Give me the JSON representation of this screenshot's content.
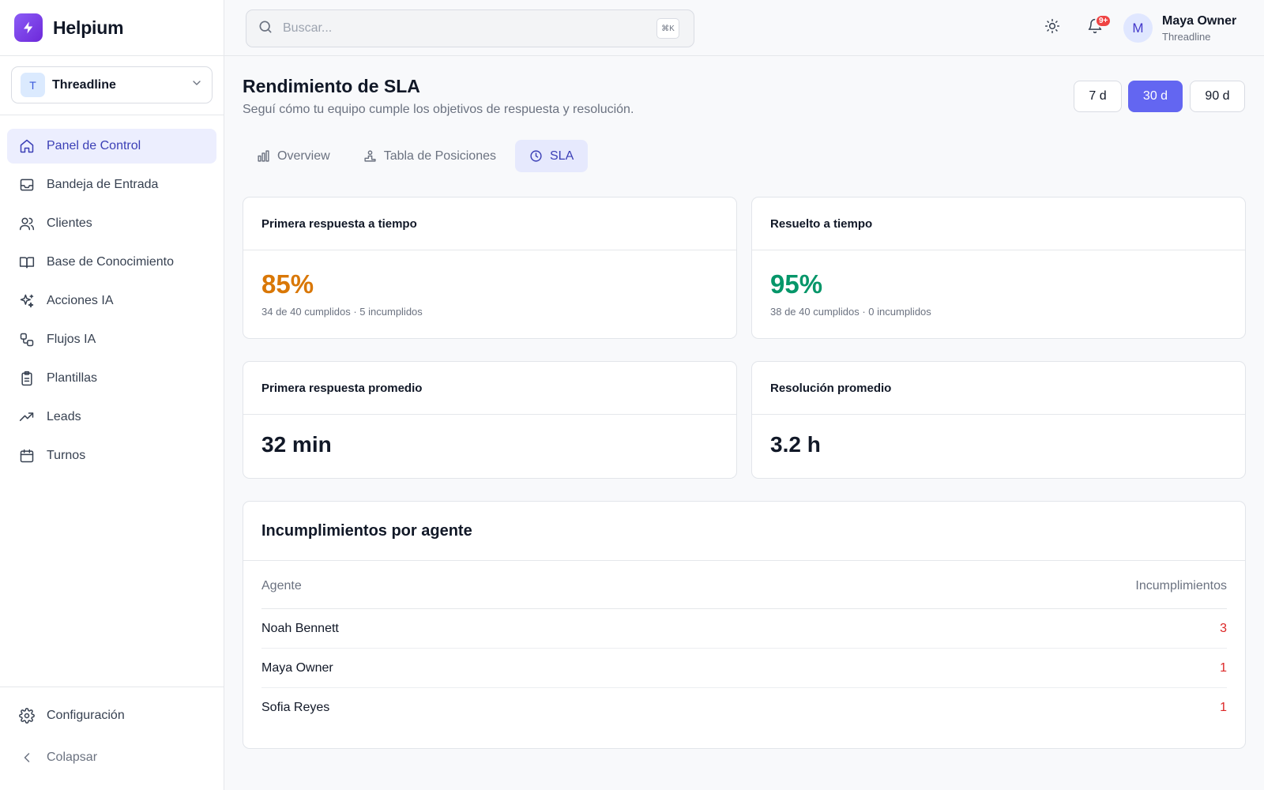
{
  "brand": {
    "name": "Helpium"
  },
  "workspace": {
    "initial": "T",
    "name": "Threadline"
  },
  "nav": {
    "items": [
      {
        "label": "Panel de Control",
        "icon": "home-icon"
      },
      {
        "label": "Bandeja de Entrada",
        "icon": "inbox-icon"
      },
      {
        "label": "Clientes",
        "icon": "users-icon"
      },
      {
        "label": "Base de Conocimiento",
        "icon": "book-icon"
      },
      {
        "label": "Acciones IA",
        "icon": "sparkles-icon"
      },
      {
        "label": "Flujos IA",
        "icon": "workflow-icon"
      },
      {
        "label": "Plantillas",
        "icon": "clipboard-icon"
      },
      {
        "label": "Leads",
        "icon": "trending-up-icon"
      },
      {
        "label": "Turnos",
        "icon": "calendar-icon"
      }
    ],
    "active_index": 0,
    "settings_label": "Configuración",
    "collapse_label": "Colapsar"
  },
  "search": {
    "placeholder": "Buscar...",
    "shortcut": "⌘K"
  },
  "notifications": {
    "badge": "9+"
  },
  "user": {
    "initial": "M",
    "name": "Maya Owner",
    "org": "Threadline"
  },
  "page": {
    "title": "Rendimiento de SLA",
    "subtitle": "Seguí cómo tu equipo cumple los objetivos de respuesta y resolución."
  },
  "ranges": [
    {
      "label": "7 d",
      "active": false
    },
    {
      "label": "30 d",
      "active": true
    },
    {
      "label": "90 d",
      "active": false
    }
  ],
  "tabs": [
    {
      "label": "Overview",
      "icon": "bar-chart-icon",
      "active": false
    },
    {
      "label": "Tabla de Posiciones",
      "icon": "podium-icon",
      "active": false
    },
    {
      "label": "SLA",
      "icon": "clock-icon",
      "active": true
    }
  ],
  "cards": {
    "first_response_on_time": {
      "title": "Primera respuesta a tiempo",
      "value": "85%",
      "detail": "34 de 40 cumplidos · 5 incumplidos",
      "color": "#d97706"
    },
    "resolved_on_time": {
      "title": "Resuelto a tiempo",
      "value": "95%",
      "detail": "38 de 40 cumplidos · 0 incumplidos",
      "color": "#059669"
    },
    "avg_first_response": {
      "title": "Primera respuesta promedio",
      "value": "32 min"
    },
    "avg_resolution": {
      "title": "Resolución promedio",
      "value": "3.2 h"
    }
  },
  "breaches": {
    "title": "Incumplimientos por agente",
    "columns": [
      "Agente",
      "Incumplimientos"
    ],
    "rows": [
      {
        "agent": "Noah Bennett",
        "count": "3"
      },
      {
        "agent": "Maya Owner",
        "count": "1"
      },
      {
        "agent": "Sofia Reyes",
        "count": "1"
      }
    ]
  }
}
